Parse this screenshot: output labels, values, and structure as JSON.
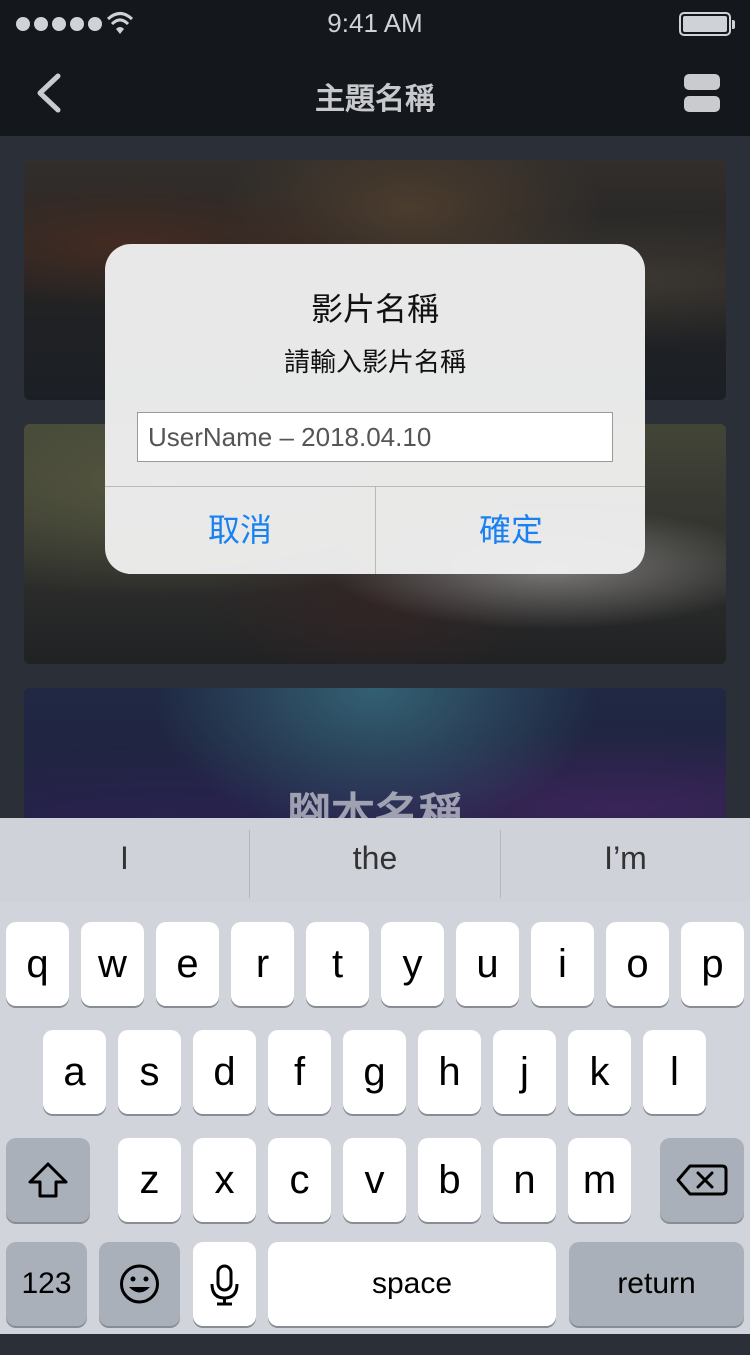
{
  "status_bar": {
    "time": "9:41 AM"
  },
  "nav": {
    "title": "主題名稱"
  },
  "cards": [
    {
      "title": ""
    },
    {
      "title": ""
    },
    {
      "title": "腳本名稱"
    }
  ],
  "dialog": {
    "title": "影片名稱",
    "message": "請輸入影片名稱",
    "input_value": "UserName – 2018.04.10",
    "cancel_label": "取消",
    "confirm_label": "確定",
    "accent_color": "#1a82f0"
  },
  "keyboard": {
    "suggestions": [
      "I",
      "the",
      "I’m"
    ],
    "row1": [
      "q",
      "w",
      "e",
      "r",
      "t",
      "y",
      "u",
      "i",
      "o",
      "p"
    ],
    "row2": [
      "a",
      "s",
      "d",
      "f",
      "g",
      "h",
      "j",
      "k",
      "l"
    ],
    "row3": [
      "z",
      "x",
      "c",
      "v",
      "b",
      "n",
      "m"
    ],
    "numbers_label": "123",
    "space_label": "space",
    "return_label": "return"
  }
}
